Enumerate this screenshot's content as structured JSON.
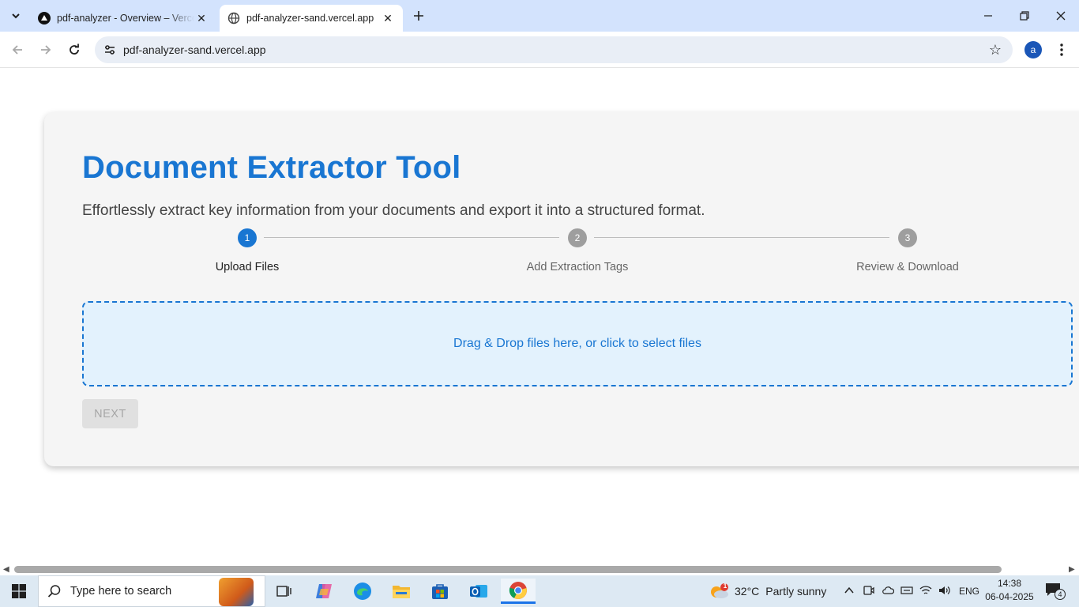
{
  "browser": {
    "tabs": [
      {
        "title": "pdf-analyzer - Overview – Vercel",
        "active": false
      },
      {
        "title": "pdf-analyzer-sand.vercel.app",
        "active": true
      }
    ],
    "url": "pdf-analyzer-sand.vercel.app",
    "profile_initial": "a"
  },
  "page": {
    "title": "Document Extractor Tool",
    "subtitle": "Effortlessly extract key information from your documents and export it into a structured format.",
    "steps": [
      {
        "number": "1",
        "label": "Upload Files",
        "active": true
      },
      {
        "number": "2",
        "label": "Add Extraction Tags",
        "active": false
      },
      {
        "number": "3",
        "label": "Review & Download",
        "active": false
      }
    ],
    "dropzone_text": "Drag & Drop files here, or click to select files",
    "next_button": "NEXT",
    "accent_color": "#1976d2"
  },
  "taskbar": {
    "search_placeholder": "Type here to search",
    "weather": {
      "temp": "32°C",
      "condition": "Partly sunny",
      "alert_count": "1"
    },
    "language": "ENG",
    "time": "14:38",
    "date": "06-04-2025",
    "notification_count": "4"
  }
}
